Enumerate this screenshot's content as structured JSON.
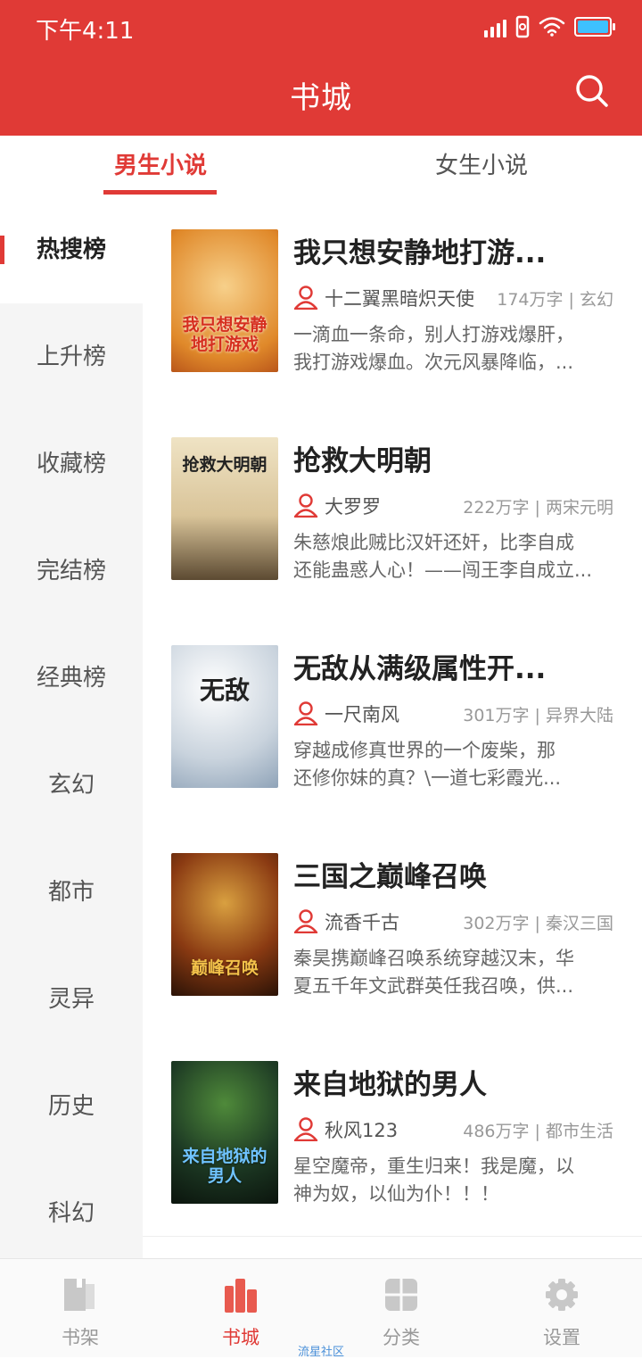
{
  "status": {
    "time": "下午4:11"
  },
  "header": {
    "title": "书城"
  },
  "tabs": [
    {
      "label": "男生小说",
      "active": true
    },
    {
      "label": "女生小说",
      "active": false
    }
  ],
  "sidebar": {
    "items": [
      {
        "label": "热搜榜",
        "active": true
      },
      {
        "label": "上升榜"
      },
      {
        "label": "收藏榜"
      },
      {
        "label": "完结榜"
      },
      {
        "label": "经典榜"
      },
      {
        "label": "玄幻"
      },
      {
        "label": "都市"
      },
      {
        "label": "灵异"
      },
      {
        "label": "历史"
      },
      {
        "label": "科幻"
      }
    ]
  },
  "books": [
    {
      "title": "我只想安静地打游...",
      "author": "十二翼黑暗炽天使",
      "meta": "174万字 | 玄幻",
      "desc1": "一滴血一条命，别人打游戏爆肝，",
      "desc2": "我打游戏爆血。次元风暴降临，...",
      "cover_text": "我只想安静地打游戏",
      "cover_color": "#e89a3c"
    },
    {
      "title": "抢救大明朝",
      "author": "大罗罗",
      "meta": "222万字 | 两宋元明",
      "desc1": "朱慈烺此贼比汉奸还奸，比李自成",
      "desc2": "还能蛊惑人心！——闯王李自成立...",
      "cover_text": "抢救大明朝",
      "cover_color": "#c9b48a"
    },
    {
      "title": "无敌从满级属性开...",
      "author": "一尺南风",
      "meta": "301万字 | 异界大陆",
      "desc1": "穿越成修真世界的一个废柴，那",
      "desc2": "还修你妹的真？\\一道七彩霞光...",
      "cover_text": "无敌",
      "cover_color": "#c6d0da"
    },
    {
      "title": "三国之巅峰召唤",
      "author": "流香千古",
      "meta": "302万字 | 秦汉三国",
      "desc1": "秦昊携巅峰召唤系统穿越汉末，华",
      "desc2": "夏五千年文武群英任我召唤，供...",
      "cover_text": "巅峰召唤",
      "cover_color": "#6b2b12"
    },
    {
      "title": "来自地狱的男人",
      "author": "秋风123",
      "meta": "486万字 | 都市生活",
      "desc1": "星空魔帝，重生归来！我是魔，以",
      "desc2": "神为奴，以仙为仆！！！",
      "cover_text": "来自地狱的男人",
      "cover_color": "#1f3a2c"
    }
  ],
  "bottom_nav": [
    {
      "label": "书架",
      "icon": "bookshelf-icon"
    },
    {
      "label": "书城",
      "icon": "bookstore-icon",
      "active": true
    },
    {
      "label": "分类",
      "icon": "category-icon"
    },
    {
      "label": "设置",
      "icon": "settings-icon"
    }
  ],
  "watermark": "流星社区",
  "colors": {
    "accent": "#e03a36",
    "sidebar_bg": "#f5f5f5"
  }
}
